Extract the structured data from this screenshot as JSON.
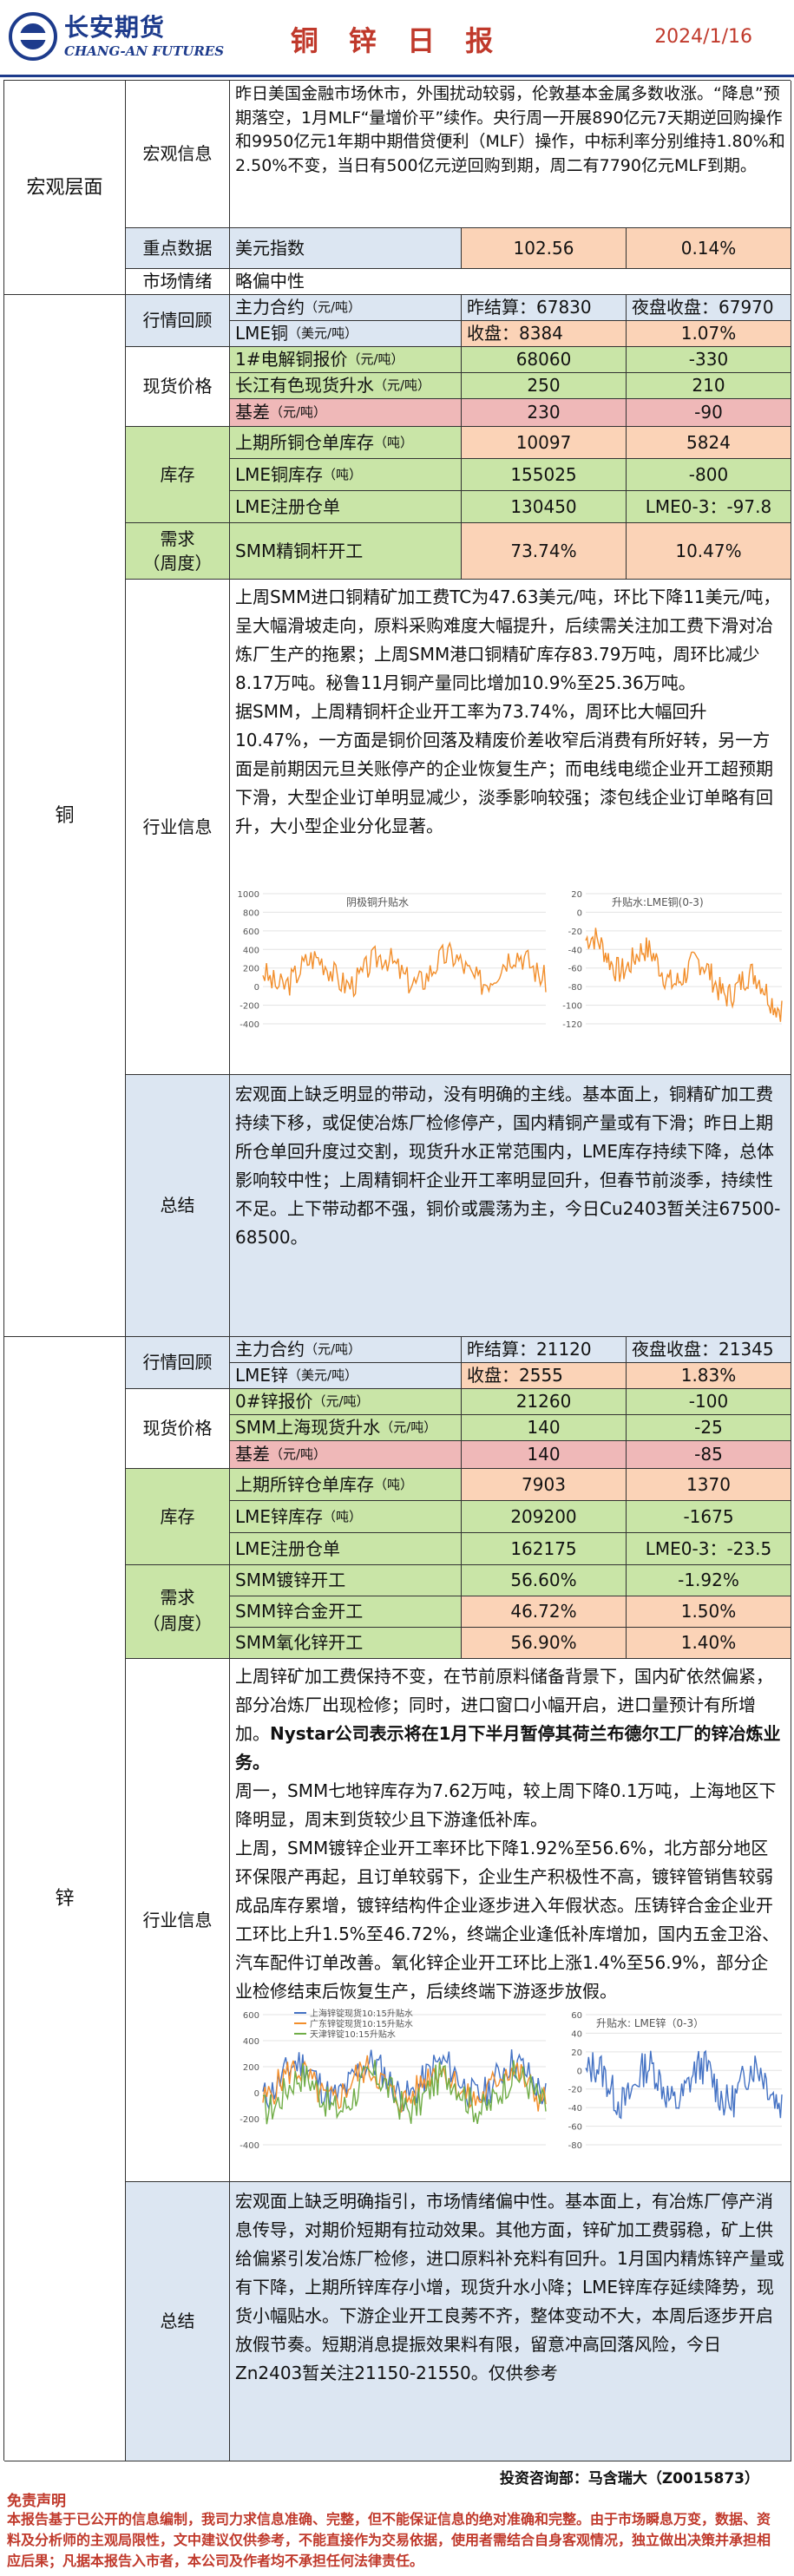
{
  "header": {
    "logo_cn": "长安期货",
    "logo_en": "CHANG-AN FUTURES",
    "title": "铜 锌 日 报",
    "date": "2024/1/16"
  },
  "macro": {
    "section": "宏观层面",
    "info_label": "宏观信息",
    "info_text": "昨日美国金融市场休市，外围扰动较弱，伦敦基本金属多数收涨。“降息”预期落空，1月MLF“量增价平”续作。央行周一开展890亿元7天期逆回购操作和9950亿元1年期中期借贷便利（MLF）操作，中标利率分别维持1.80%和2.50%不变，当日有500亿元逆回购到期，周二有7790亿元MLF到期。",
    "key_label": "重点数据",
    "usd_label": "美元指数",
    "usd_value": "102.56",
    "usd_change": "0.14%",
    "sentiment_label": "市场情绪",
    "sentiment_value": "略偏中性"
  },
  "copper": {
    "section": "铜",
    "market_label": "行情回顾",
    "main_contract": "主力合约",
    "main_unit": "（元/吨）",
    "main_close": "昨结算：67830",
    "main_night": "夜盘收盘：67970",
    "lme_label": "LME铜",
    "lme_unit": "（美元/吨）",
    "lme_close": "收盘：8384",
    "lme_change": "1.07%",
    "spot_label": "现货价格",
    "spot1_name": "1#电解铜报价",
    "spot1_unit": "（元/吨）",
    "spot1_value": "68060",
    "spot1_change": "-330",
    "spot2_name": "长江有色现货升水",
    "spot2_unit": "（元/吨）",
    "spot2_value": "250",
    "spot2_change": "210",
    "basis_name": "基差",
    "basis_unit": "（元/吨）",
    "basis_value": "230",
    "basis_change": "-90",
    "inv_label": "库存",
    "inv1_name": "上期所铜仓单库存",
    "inv1_unit": "（吨）",
    "inv1_value": "10097",
    "inv1_change": "5824",
    "inv2_name": "LME铜库存",
    "inv2_unit": "（吨）",
    "inv2_value": "155025",
    "inv2_change": "-800",
    "inv3_name": "LME注册仓单",
    "inv3_value": "130450",
    "inv3_change": "LME0-3：-97.8",
    "demand_label1": "需求",
    "demand_label2": "（周度）",
    "demand_name": "SMM精铜杆开工",
    "demand_value": "73.74%",
    "demand_change": "10.47%",
    "industry_label": "行业信息",
    "industry_p1": "上周SMM进口铜精矿加工费TC为47.63美元/吨，环比下降11美元/吨，呈大幅滑坡走向，原料采购难度大幅提升，后续需关注加工费下滑对冶炼厂生产的拖累；上周SMM港口铜精矿库存83.79万吨，周环比减少8.17万吨。秘鲁11月铜产量同比增加10.9%至25.36万吨。",
    "industry_p2": "据SMM，上周精铜杆企业开工率为73.74%，周环比大幅回升10.47%，一方面是铜价回落及精废价差收窄后消费有所好转，另一方面是前期因元旦关账停产的企业恢复生产；而电线电缆企业开工超预期下滑，大型企业订单明显减少，淡季影响较强；漆包线企业订单略有回升，大小型企业分化显著。",
    "summary_label": "总结",
    "summary": "宏观面上缺乏明显的带动，没有明确的主线。基本面上，铜精矿加工费持续下移，或促使冶炼厂检修停产，国内精铜产量或有下滑；昨日上期所仓单回升度过交割，现货升水正常范围内，LME库存持续下降，总体影响较中性；上周精铜杆企业开工率明显回升，但春节前淡季，持续性不足。上下带动都不强，铜价或震荡为主，今日Cu2403暂关注67500-68500。"
  },
  "zinc": {
    "section": "锌",
    "market_label": "行情回顾",
    "main_contract": "主力合约",
    "main_unit": "（元/吨）",
    "main_close": "昨结算：21120",
    "main_night": "夜盘收盘：21345",
    "lme_label": "LME锌",
    "lme_unit": "（美元/吨）",
    "lme_close": "收盘：2555",
    "lme_change": "1.83%",
    "spot_label": "现货价格",
    "spot1_name": "0#锌报价",
    "spot1_unit": "（元/吨）",
    "spot1_value": "21260",
    "spot1_change": "-100",
    "spot2_name": "SMM上海现货升水",
    "spot2_unit": "（元/吨）",
    "spot2_value": "140",
    "spot2_change": "-25",
    "basis_name": "基差",
    "basis_unit": "（元/吨）",
    "basis_value": "140",
    "basis_change": "-85",
    "inv_label": "库存",
    "inv1_name": "上期所锌仓单库存",
    "inv1_unit": "（吨）",
    "inv1_value": "7903",
    "inv1_change": "1370",
    "inv2_name": "LME锌库存",
    "inv2_unit": "（吨）",
    "inv2_value": "209200",
    "inv2_change": "-1675",
    "inv3_name": "LME注册仓单",
    "inv3_value": "162175",
    "inv3_change": "LME0-3：-23.5",
    "demand_label1": "需求",
    "demand_label2": "（周度）",
    "d1_name": "SMM镀锌开工",
    "d1_value": "56.60%",
    "d1_change": "-1.92%",
    "d2_name": "SMM锌合金开工",
    "d2_value": "46.72%",
    "d2_change": "1.50%",
    "d3_name": "SMM氧化锌开工",
    "d3_value": "56.90%",
    "d3_change": "1.40%",
    "industry_label": "行业信息",
    "industry_p1a": "上周锌矿加工费保持不变，在节前原料储备背景下，国内矿依然偏紧，部分冶炼厂出现检修；同时，进口窗口小幅开启，进口量预计有所增加。",
    "industry_p1b": "Nystar公司表示将在1月下半月暂停其荷兰布德尔工厂的锌冶炼业务。",
    "industry_p2": "周一，SMM七地锌库存为7.62万吨，较上周下降0.1万吨，上海地区下降明显，周末到货较少且下游逢低补库。",
    "industry_p3": "上周，SMM镀锌企业开工率环比下降1.92%至56.6%，北方部分地区环保限产再起，且订单较弱下，企业生产积极性不高，镀锌管销售较弱成品库存累增，镀锌结构件企业逐步进入年假状态。压铸锌合金企业开工环比上升1.5%至46.72%，终端企业逢低补库增加，国内五金卫浴、汽车配件订单改善。氧化锌企业开工环比上涨1.4%至56.9%，部分企业检修结束后恢复生产，后续终端下游逐步放假。",
    "summary_label": "总结",
    "summary": "宏观面上缺乏明确指引，市场情绪偏中性。基本面上，有冶炼厂停产消息传导，对期价短期有拉动效果。其他方面，锌矿加工费弱稳，矿上供给偏紧引发冶炼厂检修，进口原料补充料有回升。1月国内精炼锌产量或有下降，上期所锌库存小增，现货升水小降；LME锌库存延续降势，现货小幅贴水。下游企业开工良莠不齐，整体变动不大，本周后逐步开启放假节奏。短期消息提振效果料有限，留意冲高回落风险，今日Zn2403暂关注21150-21550。仅供参考"
  },
  "charts": {
    "cu_left_title": "阴极铜升贴水",
    "cu_right_title": "升贴水:LME铜(0-3)",
    "zn_left_legend": [
      "上海锌锭现货10:15升贴水",
      "广东锌锭现货10:15升贴水",
      "天津锌锭10:15升贴水"
    ],
    "zn_right_title": "升贴水: LME锌（0-3）",
    "colors": {
      "orange": "#f28e2b",
      "blue": "#4472c4",
      "green": "#70ad47",
      "red": "#c0392b"
    }
  },
  "footer": {
    "advisor": "投资咨询部：马含瑞大（Z0015873）",
    "disclaimer_title": "免责声明",
    "disclaimer_text": "本报告基于已公开的信息编制，我司力求信息准确、完整，但不能保证信息的绝对准确和完整。由于市场瞬息万变，数据、资料及分析师的主观局限性，文中建议仅供参考，不能直接作为交易依据，使用者需结合自身客观情况，独立做出决策并承担相应后果；凡据本报告入市者，本公司及作者均不承担任何法律责任。"
  }
}
